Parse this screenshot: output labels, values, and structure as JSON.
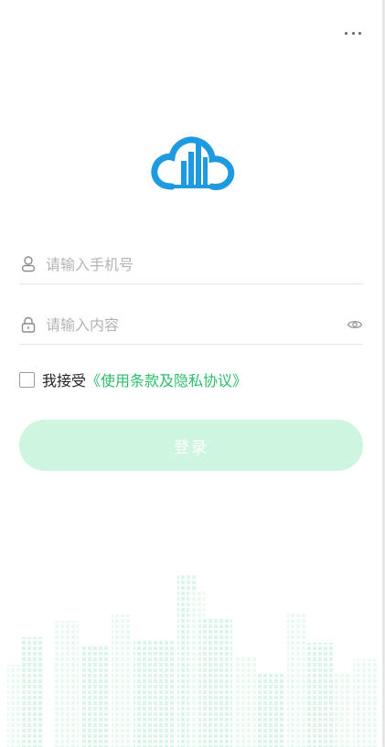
{
  "header": {
    "more_icon": "more-horizontal-icon"
  },
  "logo": {
    "name": "cloud-building-logo",
    "color": "#1e9be0"
  },
  "phone_field": {
    "placeholder": "请输入手机号",
    "icon": "user-icon"
  },
  "password_field": {
    "placeholder": "请输入内容",
    "icon": "lock-icon",
    "toggle_icon": "eye-icon"
  },
  "agreement": {
    "prefix": "我接受",
    "link": "《使用条款及隐私协议》",
    "checked": false
  },
  "login_button": {
    "label": "登录",
    "color": "#cdf5e0"
  },
  "colors": {
    "accent": "#2dbd6b",
    "placeholder": "#b3b3b3",
    "divider": "#e5e5e5"
  }
}
